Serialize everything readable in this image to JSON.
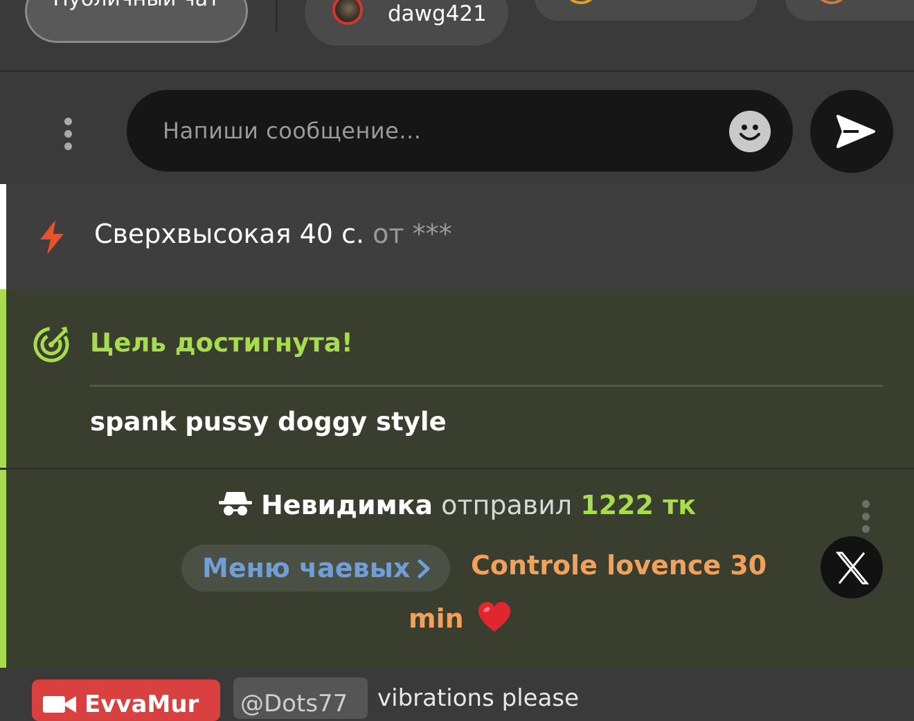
{
  "tabs": {
    "public_label": "Публичный чат",
    "user_tab_name": "dawg421"
  },
  "composer": {
    "placeholder": "Напиши сообщение..."
  },
  "messages": {
    "speed_notice": {
      "label": "Сверхвысокая 40 с.",
      "from_label": "от ***"
    },
    "goal": {
      "title": "Цель достигнута!",
      "description": "spank pussy doggy style"
    },
    "tip": {
      "sender": "Невидимка",
      "verb": "отправил",
      "amount": "1222 тк",
      "menu_label": "Меню чаевых",
      "item_line1": "Controle lovence 30",
      "item_line2": "min",
      "heart": "❤️"
    },
    "bottom": {
      "username": "EvvaMur",
      "mention": "@Dots77",
      "text": "vibrations please"
    }
  },
  "colors": {
    "accent_green": "#a6dc4e",
    "tip_item_orange": "#f2a05a",
    "tip_menu_blue": "#6f9ed8",
    "bolt_orange": "#e8522a",
    "user_badge_red": "#d8413f"
  },
  "icons": [
    "more-vertical-icon",
    "emoji-icon",
    "send-icon",
    "lightning-icon",
    "target-icon",
    "incognito-icon",
    "chevron-right-icon",
    "close-x-icon",
    "camera-icon"
  ]
}
